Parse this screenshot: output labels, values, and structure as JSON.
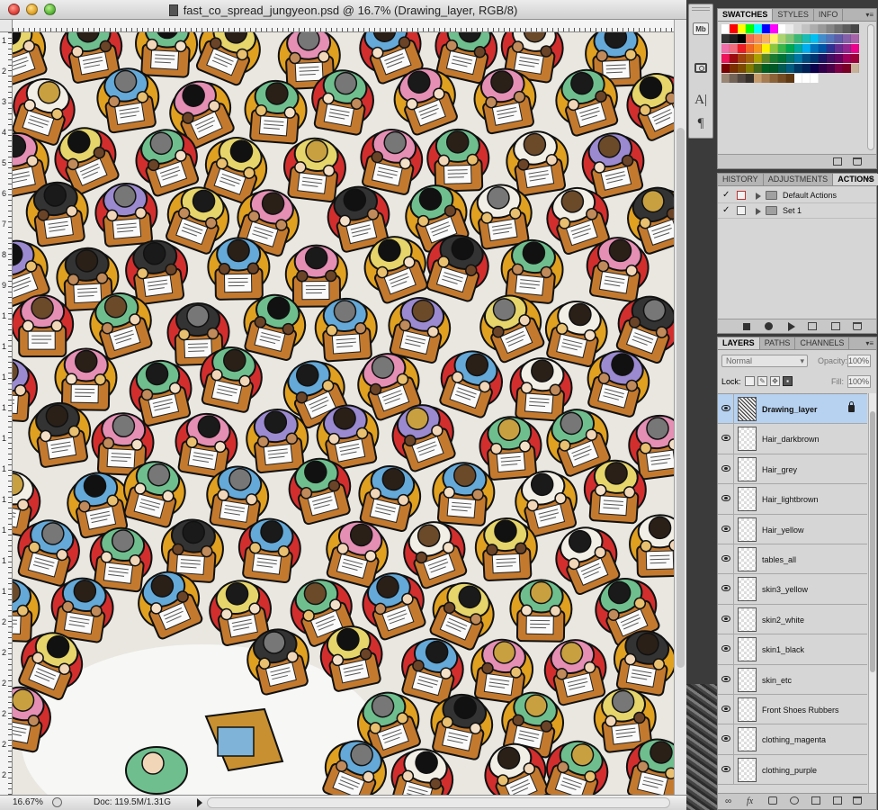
{
  "window": {
    "title": "fast_co_spread_jungyeon.psd @ 16.7% (Drawing_layer, RGB/8)"
  },
  "ruler": {
    "left_numbers": [
      "1",
      "2",
      "3",
      "4",
      "5",
      "6",
      "7",
      "8",
      "9",
      "1",
      "1",
      "1",
      "1",
      "1",
      "1",
      "1",
      "1",
      "1",
      "1",
      "2",
      "2",
      "2",
      "2",
      "2",
      "2"
    ]
  },
  "status": {
    "zoom": "16.67%",
    "doc_info": "Doc: 119.5M/1.31G"
  },
  "icon_dock": {
    "mb_label": "Mb",
    "char_glyph": "A|",
    "para_glyph": "¶"
  },
  "swatches": {
    "tabs": [
      "SWATCHES",
      "STYLES",
      "INFO"
    ],
    "active_tab": 0,
    "colors": [
      "#ffffff",
      "#ff0000",
      "#ffff00",
      "#00ff00",
      "#00ffff",
      "#0000ff",
      "#ff00ff",
      "#ffffff",
      "#ebebeb",
      "#d6d6d6",
      "#c2c2c2",
      "#adadad",
      "#999999",
      "#858585",
      "#707070",
      "#5c5c5c",
      "#474747",
      "#333333",
      "#1f1f1f",
      "#000000",
      "#f26c4f",
      "#f68e55",
      "#fbaf5c",
      "#fff467",
      "#acd372",
      "#7cc576",
      "#3bb878",
      "#1abbb4",
      "#00bff3",
      "#438ccb",
      "#5574b9",
      "#605ca8",
      "#855fa8",
      "#a763a8",
      "#f06ea9",
      "#f26d7d",
      "#ed1c24",
      "#f26522",
      "#f7941d",
      "#fff200",
      "#8dc63f",
      "#39b54a",
      "#00a651",
      "#00a99d",
      "#00aeef",
      "#0072bc",
      "#0054a6",
      "#2e3192",
      "#662d91",
      "#92278f",
      "#ec008c",
      "#ed145b",
      "#9e0b0f",
      "#a0410d",
      "#a36209",
      "#aba000",
      "#598527",
      "#1a7b30",
      "#007236",
      "#00746b",
      "#0076a3",
      "#004b80",
      "#003471",
      "#1b1464",
      "#440e62",
      "#630460",
      "#9e005d",
      "#9e0039",
      "#790000",
      "#7b2e00",
      "#7d4900",
      "#827b00",
      "#406618",
      "#005e20",
      "#005826",
      "#005952",
      "#005b7f",
      "#003663",
      "#002157",
      "#0d004c",
      "#32004b",
      "#4b0049",
      "#7b0046",
      "#7a0026",
      "#c7b299",
      "#998675",
      "#736357",
      "#534741",
      "#37302a",
      "#c69c6d",
      "#a67c52",
      "#8c6239",
      "#754c24",
      "#603913",
      "#ffffff",
      "#ffffff",
      "#ffffff"
    ],
    "footer_icons": [
      "new-swatch-icon",
      "trash-icon"
    ]
  },
  "actions": {
    "tabs": [
      "HISTORY",
      "ADJUSTMENTS",
      "ACTIONS"
    ],
    "active_tab": 2,
    "rows": [
      {
        "check": "✓",
        "label": "Default Actions"
      },
      {
        "check": "✓",
        "label": "Set 1"
      }
    ],
    "footer_icons": [
      "stop-icon",
      "record-icon",
      "play-icon",
      "new-set-icon",
      "new-action-icon",
      "trash-icon"
    ]
  },
  "layers": {
    "tabs": [
      "LAYERS",
      "PATHS",
      "CHANNELS"
    ],
    "active_tab": 0,
    "blend_mode": "Normal",
    "opacity_label": "Opacity:",
    "opacity": "100%",
    "lock_label": "Lock:",
    "fill_label": "Fill:",
    "fill": "100%",
    "items": [
      {
        "name": "Drawing_layer",
        "selected": true,
        "locked": true
      },
      {
        "name": "Hair_darkbrown"
      },
      {
        "name": "Hair_grey"
      },
      {
        "name": "Hair_lightbrown"
      },
      {
        "name": "Hair_yellow"
      },
      {
        "name": "tables_all"
      },
      {
        "name": "skin3_yellow"
      },
      {
        "name": "skin2_white"
      },
      {
        "name": "skin1_black"
      },
      {
        "name": "skin_etc"
      },
      {
        "name": "Front Shoes Rubbers"
      },
      {
        "name": "clothing_magenta"
      },
      {
        "name": "clothing_purple"
      }
    ],
    "footer_icons": [
      "link-icon",
      "fx-icon",
      "mask-icon",
      "adjustment-icon",
      "group-icon",
      "new-layer-icon",
      "trash-icon"
    ]
  }
}
